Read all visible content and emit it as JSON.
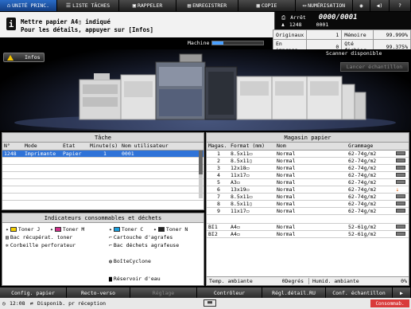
{
  "tabs": [
    {
      "label": "UNITÉ PRINC.",
      "icon": "home-icon"
    },
    {
      "label": "LISTE TÂCHES",
      "icon": "list-icon"
    },
    {
      "label": "RAPPELER",
      "icon": "folder-icon"
    },
    {
      "label": "ENREGISTRER",
      "icon": "save-icon"
    },
    {
      "label": "COPIE",
      "icon": "copy-icon"
    },
    {
      "label": "NUMÉRISATION",
      "icon": "scan-icon"
    }
  ],
  "message": {
    "line1": "Mettre papier  A4▯    indiqué",
    "line2": "Pour les détails, appuyer sur [Infos]"
  },
  "status": {
    "state": "Arrêt",
    "count": "0000/0001",
    "user_id": "1248",
    "user_no": "0001",
    "machine_label": "Machine"
  },
  "counters": {
    "originaux_label": "Originaux",
    "originaux_value": "1",
    "memoire_label": "Mémoire",
    "memoire_value": "99.999%",
    "en_impress_label": "En impress.",
    "en_impress_value": "0",
    "qte_fichier_label": "Qté fichier",
    "qte_fichier_value": "99.375%"
  },
  "hero": {
    "infos_label": "Infos",
    "scanner_status": "Scanner disponible",
    "lance_label": "Lancer échantillon"
  },
  "task_panel": {
    "title": "Tâche",
    "headers": [
      "N°",
      "Mode",
      "Etat",
      "Minute(s)",
      "Nom utilisateur"
    ],
    "rows": [
      [
        "1248",
        "Imprimante",
        "Papier",
        "1",
        "0001"
      ]
    ]
  },
  "consumables": {
    "title": "Indicateurs consommables et déchets",
    "items": [
      {
        "label": "Toner J"
      },
      {
        "label": "Toner M"
      },
      {
        "label": "Toner C"
      },
      {
        "label": "Toner N"
      },
      {
        "label": "Bac récupérat. toner"
      },
      {
        "label": "Cartouche d'agrafes"
      },
      {
        "label": "Corbeille perforateur"
      },
      {
        "label": "Bac déchets agrafeuse"
      },
      {
        "label": "BoîteCyclone"
      },
      {
        "label": "Réservoir d'eau"
      }
    ]
  },
  "magazine": {
    "title": "Magasin papier",
    "headers": [
      "Magas.",
      "Format (mm)",
      "Nom",
      "Grammage"
    ],
    "rows": [
      [
        "1",
        "8.5x11▭",
        "Normal",
        "62-74g/m2"
      ],
      [
        "2",
        "8.5x11▯",
        "Normal",
        "62-74g/m2"
      ],
      [
        "3",
        "12x18▭",
        "Normal",
        "62-74g/m2"
      ],
      [
        "4",
        "11x17▭",
        "Normal",
        "62-74g/m2"
      ],
      [
        "5",
        "A3▭",
        "Normal",
        "62-74g/m2"
      ],
      [
        "6",
        "13x19▭",
        "Normal",
        "62-74g/m2"
      ],
      [
        "7",
        "8.5x11▭",
        "Normal",
        "62-74g/m2"
      ],
      [
        "8",
        "8.5x11▯",
        "Normal",
        "62-74g/m2"
      ],
      [
        "9",
        "11x17▭",
        "Normal",
        "62-74g/m2"
      ]
    ],
    "bypass_rows": [
      [
        "BI1",
        "A4▭",
        "Normal",
        "52-61g/m2"
      ],
      [
        "BI2",
        "A4▭",
        "Normal",
        "52-61g/m2"
      ]
    ],
    "temp_label": "Temp. ambiante",
    "temp_value": "0Degrés",
    "humid_label": "Humid. ambiante",
    "humid_value": "0%"
  },
  "bottom_buttons": [
    {
      "label": "Config. papier",
      "enabled": true
    },
    {
      "label": "Recto-verso",
      "enabled": true
    },
    {
      "label": "Réglage",
      "enabled": false
    },
    {
      "label": "Contrôleur",
      "enabled": true
    },
    {
      "label": "Régl.détail.RU",
      "enabled": true
    },
    {
      "label": "Conf. échantillon",
      "enabled": true
    }
  ],
  "statusline": {
    "time": "12:08",
    "message": "Disponib. pr réception",
    "consumables": "Consommab."
  }
}
